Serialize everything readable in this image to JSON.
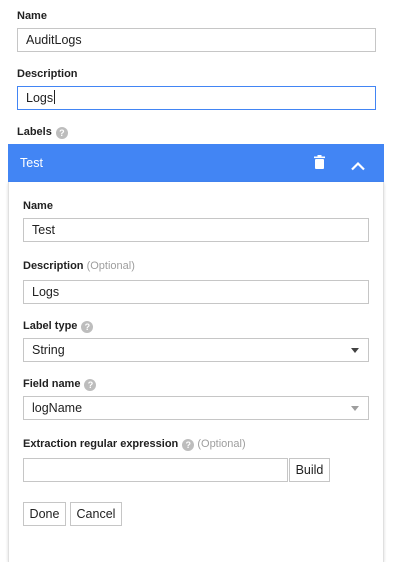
{
  "form": {
    "name_label": "Name",
    "name_value": "AuditLogs",
    "description_label": "Description",
    "description_value": "Logs",
    "labels_label": "Labels"
  },
  "label_panel": {
    "title": "Test",
    "name_label": "Name",
    "name_value": "Test",
    "description_label": "Description",
    "description_optional": "(Optional)",
    "description_value": "Logs",
    "label_type_label": "Label type",
    "label_type_value": "String",
    "field_name_label": "Field name",
    "field_name_value": "logName",
    "regex_label": "Extraction regular expression",
    "regex_optional": "(Optional)",
    "regex_value": "",
    "build_label": "Build",
    "done_label": "Done",
    "cancel_label": "Cancel"
  },
  "icons": {
    "help": "?",
    "delete": "trash-icon",
    "collapse": "chevron-up-icon"
  },
  "colors": {
    "accent": "#4285f4",
    "focus_border": "#4285f4"
  }
}
